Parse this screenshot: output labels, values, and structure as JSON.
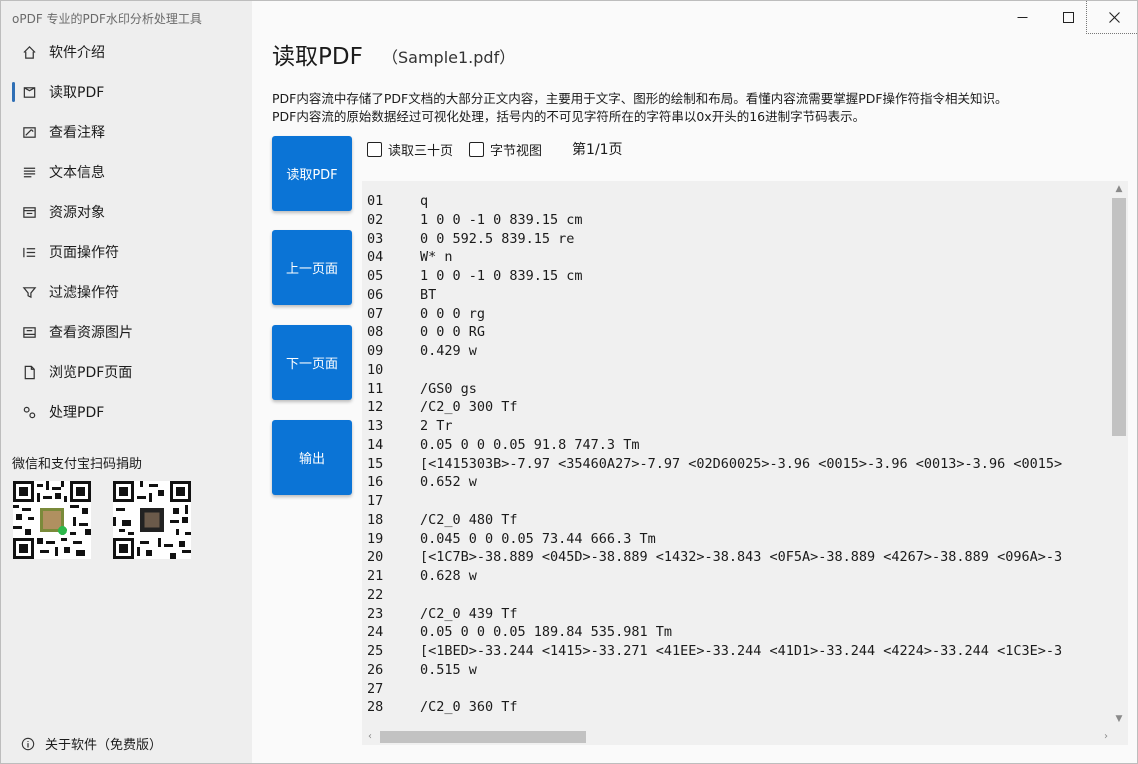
{
  "app": {
    "title": "oPDF 专业的PDF水印分析处理工具"
  },
  "sidebar": {
    "items": [
      {
        "label": "软件介绍",
        "icon": "home-icon"
      },
      {
        "label": "读取PDF",
        "icon": "read-icon",
        "active": true
      },
      {
        "label": "查看注释",
        "icon": "annotation-icon"
      },
      {
        "label": "文本信息",
        "icon": "text-icon"
      },
      {
        "label": "资源对象",
        "icon": "resource-icon"
      },
      {
        "label": "页面操作符",
        "icon": "list-icon"
      },
      {
        "label": "过滤操作符",
        "icon": "filter-icon"
      },
      {
        "label": "查看资源图片",
        "icon": "image-icon"
      },
      {
        "label": "浏览PDF页面",
        "icon": "page-icon"
      },
      {
        "label": "处理PDF",
        "icon": "gear-icon"
      }
    ],
    "donate_label": "微信和支付宝扫码捐助",
    "about_label": "关于软件（免费版）"
  },
  "main": {
    "title": "读取PDF",
    "filename": "（Sample1.pdf）",
    "desc_line1": "PDF内容流中存储了PDF文档的大部分正文内容，主要用于文字、图形的绘制和布局。看懂内容流需要掌握PDF操作符指令相关知识。",
    "desc_line2": "PDF内容流的原始数据经过可视化处理，括号内的不可见字符所在的字符串以0x开头的16进制字节码表示。",
    "buttons": {
      "read": "读取PDF",
      "prev": "上一页面",
      "next": "下一页面",
      "export": "输出"
    },
    "options": {
      "read_thirty": "读取三十页",
      "byte_view": "字节视图",
      "page_indicator": "第1/1页"
    },
    "code_lines": [
      [
        "01",
        "q"
      ],
      [
        "02",
        "1 0 0 -1 0 839.15 cm"
      ],
      [
        "03",
        "0 0 592.5 839.15 re"
      ],
      [
        "04",
        "W* n"
      ],
      [
        "05",
        "1 0 0 -1 0 839.15 cm"
      ],
      [
        "06",
        "BT"
      ],
      [
        "07",
        "0 0 0 rg"
      ],
      [
        "08",
        "0 0 0 RG"
      ],
      [
        "09",
        "0.429 w"
      ],
      [
        "10",
        ""
      ],
      [
        "11",
        "/GS0 gs"
      ],
      [
        "12",
        "/C2_0 300 Tf"
      ],
      [
        "13",
        "2 Tr"
      ],
      [
        "14",
        "0.05 0 0 0.05 91.8 747.3 Tm"
      ],
      [
        "15",
        "[<1415303B>-7.97 <35460A27>-7.97 <02D60025>-3.96 <0015>-3.96 <0013>-3.96 <0015>"
      ],
      [
        "16",
        "0.652 w"
      ],
      [
        "17",
        ""
      ],
      [
        "18",
        "/C2_0 480 Tf"
      ],
      [
        "19",
        "0.045 0 0 0.05 73.44 666.3 Tm"
      ],
      [
        "20",
        "[<1C7B>-38.889 <045D>-38.889 <1432>-38.843 <0F5A>-38.889 <4267>-38.889 <096A>-3"
      ],
      [
        "21",
        "0.628 w"
      ],
      [
        "22",
        ""
      ],
      [
        "23",
        "/C2_0 439 Tf"
      ],
      [
        "24",
        "0.05 0 0 0.05 189.84 535.981 Tm"
      ],
      [
        "25",
        "[<1BED>-33.244 <1415>-33.271 <41EE>-33.244 <41D1>-33.244 <4224>-33.244 <1C3E>-3"
      ],
      [
        "26",
        "0.515 w"
      ],
      [
        "27",
        ""
      ],
      [
        "28",
        "/C2_0 360 Tf"
      ]
    ]
  },
  "colors": {
    "accent": "#0b74d6",
    "active_indicator": "#2f6fb5"
  }
}
